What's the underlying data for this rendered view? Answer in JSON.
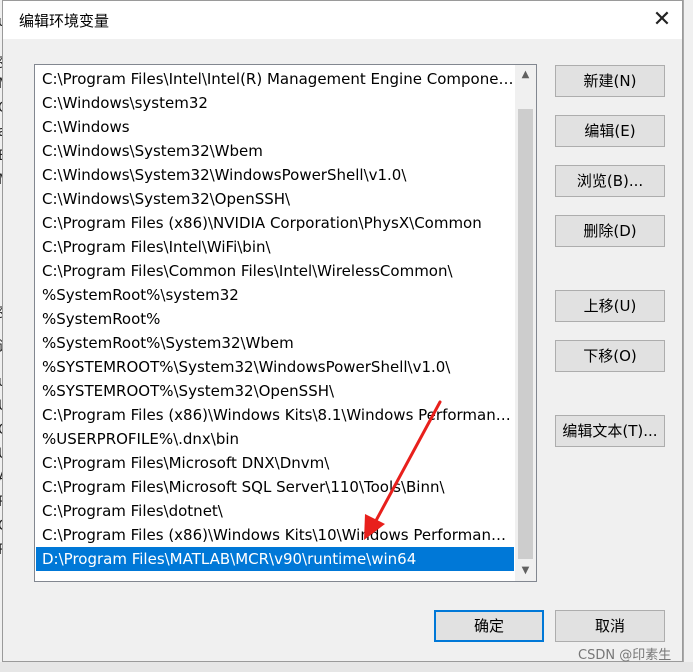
{
  "dialog": {
    "title": "编辑环境变量",
    "close_glyph": "✕"
  },
  "path_entries": [
    "C:\\Program Files\\Intel\\Intel(R) Management Engine Componen...",
    "C:\\Windows\\system32",
    "C:\\Windows",
    "C:\\Windows\\System32\\Wbem",
    "C:\\Windows\\System32\\WindowsPowerShell\\v1.0\\",
    "C:\\Windows\\System32\\OpenSSH\\",
    "C:\\Program Files (x86)\\NVIDIA Corporation\\PhysX\\Common",
    "C:\\Program Files\\Intel\\WiFi\\bin\\",
    "C:\\Program Files\\Common Files\\Intel\\WirelessCommon\\",
    "%SystemRoot%\\system32",
    "%SystemRoot%",
    "%SystemRoot%\\System32\\Wbem",
    "%SYSTEMROOT%\\System32\\WindowsPowerShell\\v1.0\\",
    "%SYSTEMROOT%\\System32\\OpenSSH\\",
    "C:\\Program Files (x86)\\Windows Kits\\8.1\\Windows Performanc...",
    "%USERPROFILE%\\.dnx\\bin",
    "C:\\Program Files\\Microsoft DNX\\Dnvm\\",
    "C:\\Program Files\\Microsoft SQL Server\\110\\Tools\\Binn\\",
    "C:\\Program Files\\dotnet\\",
    "C:\\Program Files (x86)\\Windows Kits\\10\\Windows Performance...",
    "D:\\Program Files\\MATLAB\\MCR\\v90\\runtime\\win64"
  ],
  "selected_index": 20,
  "buttons": {
    "new": "新建(N)",
    "edit": "编辑(E)",
    "browse": "浏览(B)...",
    "delete": "删除(D)",
    "move_up": "上移(U)",
    "move_down": "下移(O)",
    "edit_text": "编辑文本(T)...",
    "ok": "确定",
    "cancel": "取消"
  },
  "scrollbar": {
    "up_glyph": "▲",
    "down_glyph": "▼"
  },
  "background_fragments": [
    "uj",
    "变",
    "M",
    "Or",
    "a",
    "E",
    "M",
    "变",
    "设",
    "uj",
    "U",
    "OS",
    "U",
    "A",
    "R",
    "C",
    "R"
  ],
  "watermark": "CSDN @印素生",
  "colors": {
    "selection": "#0078d7",
    "annotation_arrow": "#e8201c",
    "default_button_border": "#0078d7"
  }
}
